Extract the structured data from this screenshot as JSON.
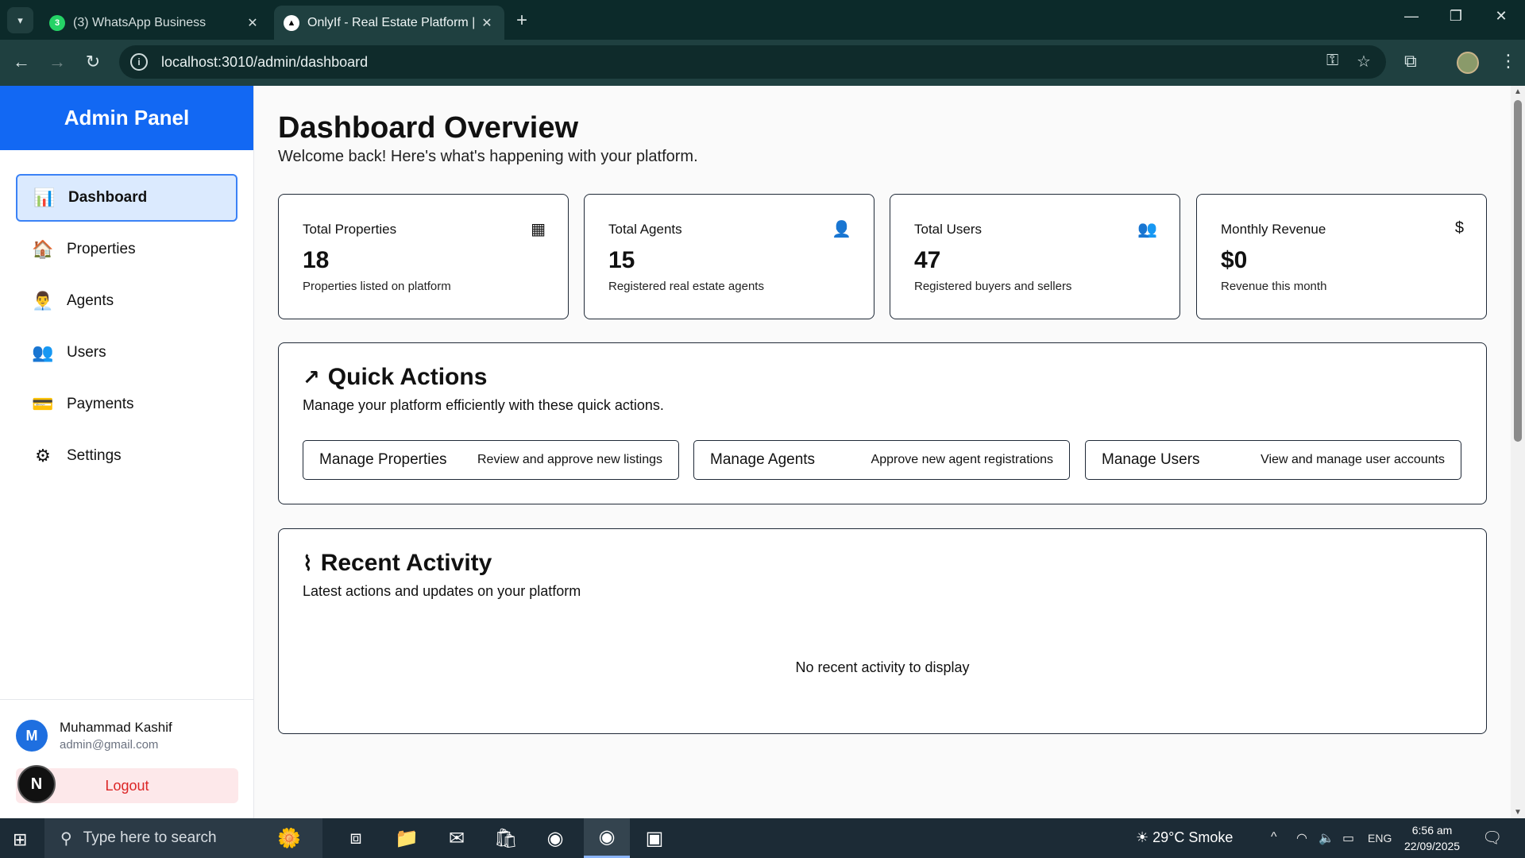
{
  "browser": {
    "tabs": [
      {
        "title": "(3) WhatsApp Business",
        "badge": "3"
      },
      {
        "title": "OnlyIf - Real Estate Platform | B"
      }
    ],
    "url": "localhost:3010/admin/dashboard"
  },
  "sidebar": {
    "brand": "Admin Panel",
    "items": [
      {
        "label": "Dashboard",
        "icon": "bar-chart-icon"
      },
      {
        "label": "Properties",
        "icon": "house-icon"
      },
      {
        "label": "Agents",
        "icon": "agent-icon"
      },
      {
        "label": "Users",
        "icon": "users-icon"
      },
      {
        "label": "Payments",
        "icon": "card-icon"
      },
      {
        "label": "Settings",
        "icon": "gear-icon"
      }
    ],
    "user": {
      "initial": "M",
      "name": "Muhammad Kashif",
      "email": "admin@gmail.com"
    },
    "logout_label": "Logout",
    "dev_badge": "N"
  },
  "main": {
    "title": "Dashboard Overview",
    "subtitle": "Welcome back! Here's what's happening with your platform.",
    "stats": [
      {
        "label": "Total Properties",
        "value": "18",
        "desc": "Properties listed on platform",
        "icon": "building-icon"
      },
      {
        "label": "Total Agents",
        "value": "15",
        "desc": "Registered real estate agents",
        "icon": "user-check-icon"
      },
      {
        "label": "Total Users",
        "value": "47",
        "desc": "Registered buyers and sellers",
        "icon": "users-icon"
      },
      {
        "label": "Monthly Revenue",
        "value": "$0",
        "desc": "Revenue this month",
        "icon": "dollar-icon"
      }
    ],
    "quick_actions": {
      "title": "Quick Actions",
      "desc": "Manage your platform efficiently with these quick actions.",
      "actions": [
        {
          "title": "Manage Properties",
          "desc": "Review and approve new listings"
        },
        {
          "title": "Manage Agents",
          "desc": "Approve new agent registrations"
        },
        {
          "title": "Manage Users",
          "desc": "View and manage user accounts"
        }
      ]
    },
    "recent_activity": {
      "title": "Recent Activity",
      "desc": "Latest actions and updates on your platform",
      "empty": "No recent activity to display"
    }
  },
  "taskbar": {
    "search_placeholder": "Type here to search",
    "weather": "29°C  Smoke",
    "lang": "ENG",
    "time": "6:56 am",
    "date": "22/09/2025"
  },
  "colors": {
    "brand": "#1268f3",
    "active_nav_bg": "#dbeafe",
    "logout_text": "#dc2626"
  }
}
